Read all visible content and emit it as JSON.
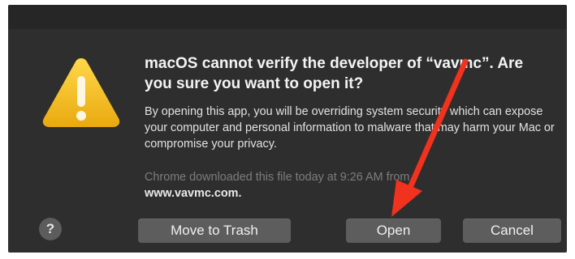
{
  "dialog": {
    "title": "macOS cannot verify the developer of “vavmc”. Are you sure you want to open it?",
    "body": "By opening this app, you will be overriding system security which can expose your computer and personal information to malware that may harm your Mac or compromise your privacy.",
    "source_line": "Chrome downloaded this file today at 9:26 AM from",
    "source_domain": "www.vavmc.com.",
    "icon": "warning-triangle-icon"
  },
  "buttons": {
    "help": "?",
    "move_to_trash": "Move to Trash",
    "open": "Open",
    "cancel": "Cancel"
  },
  "colors": {
    "dialog_bg": "#2f2e2e",
    "warning_yellow": "#f2c027",
    "annotation_arrow": "#f0321e"
  }
}
